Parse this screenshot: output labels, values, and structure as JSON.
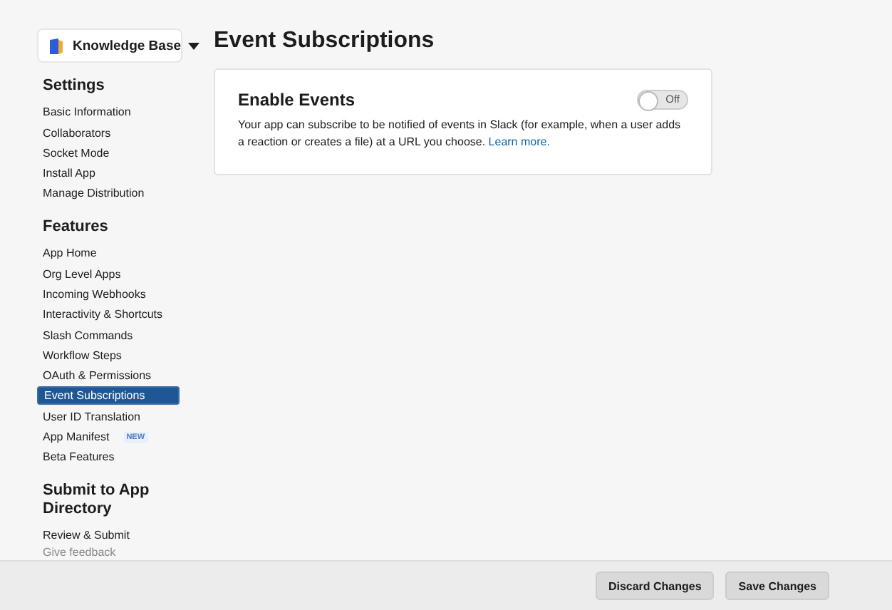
{
  "app_selector": {
    "label": "Knowledge Base"
  },
  "sidebar": {
    "sections": [
      {
        "title": "Settings",
        "items": [
          {
            "label": "Basic Information",
            "selected": false
          },
          {
            "label": "Collaborators",
            "selected": false
          },
          {
            "label": "Socket Mode",
            "selected": false
          },
          {
            "label": "Install App",
            "selected": false
          },
          {
            "label": "Manage Distribution",
            "selected": false
          }
        ]
      },
      {
        "title": "Features",
        "items": [
          {
            "label": "App Home",
            "selected": false
          },
          {
            "label": "Org Level Apps",
            "selected": false
          },
          {
            "label": "Incoming Webhooks",
            "selected": false
          },
          {
            "label": "Interactivity & Shortcuts",
            "selected": false
          },
          {
            "label": "Slash Commands",
            "selected": false
          },
          {
            "label": "Workflow Steps",
            "selected": false
          },
          {
            "label": "OAuth & Permissions",
            "selected": false
          },
          {
            "label": "Event Subscriptions",
            "selected": true
          },
          {
            "label": "User ID Translation",
            "selected": false
          },
          {
            "label": "App Manifest",
            "badge": "NEW",
            "selected": false
          },
          {
            "label": "Beta Features",
            "selected": false
          }
        ]
      },
      {
        "title": "Submit to App Directory",
        "items": [
          {
            "label": "Review & Submit",
            "selected": false
          }
        ]
      }
    ],
    "feedback": "Give feedback"
  },
  "page_title": "Event Subscriptions",
  "card": {
    "title": "Enable Events",
    "toggle": {
      "on": false,
      "label": "Off"
    },
    "description": "Your app can subscribe to be notified of events in Slack (for example, when a user adds a reaction or creates a file) at a URL you choose.",
    "link": "Learn more."
  },
  "footer": {
    "buttons": [
      "Discard Changes",
      "Save Changes"
    ]
  }
}
